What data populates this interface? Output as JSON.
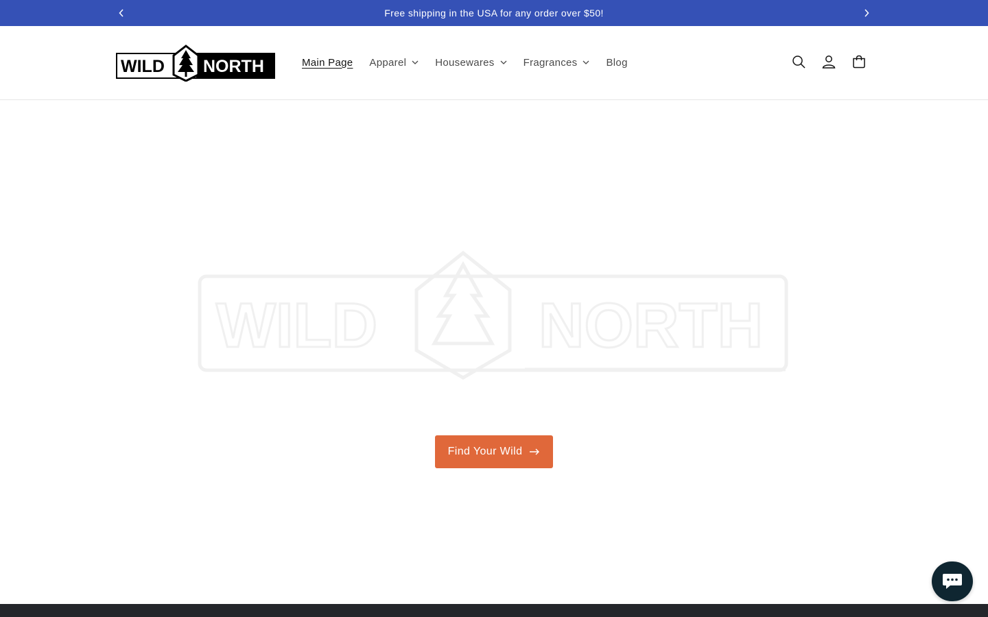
{
  "colors": {
    "announcement_bg": "#3551b6",
    "cta_bg": "#e0683a",
    "footer_bg": "#24262b",
    "chat_bg": "#0f2631"
  },
  "announcement": {
    "message": "Free shipping in the USA for any order over $50!",
    "prev_icon": "chevron-left-icon",
    "next_icon": "chevron-right-icon"
  },
  "header": {
    "logo": {
      "text_left": "WILD",
      "text_right": "NORTH"
    },
    "nav": [
      {
        "label": "Main Page",
        "active": true,
        "dropdown": false
      },
      {
        "label": "Apparel",
        "active": false,
        "dropdown": true
      },
      {
        "label": "Housewares",
        "active": false,
        "dropdown": true
      },
      {
        "label": "Fragrances",
        "active": false,
        "dropdown": true
      },
      {
        "label": "Blog",
        "active": false,
        "dropdown": false
      }
    ],
    "icons": [
      "search-icon",
      "account-icon",
      "cart-icon"
    ]
  },
  "hero": {
    "logo": {
      "text_left": "WILD",
      "text_right": "NORTH"
    },
    "cta_label": "Find Your Wild",
    "cta_icon": "arrow-right-icon"
  },
  "chat": {
    "icon": "chat-icon"
  }
}
